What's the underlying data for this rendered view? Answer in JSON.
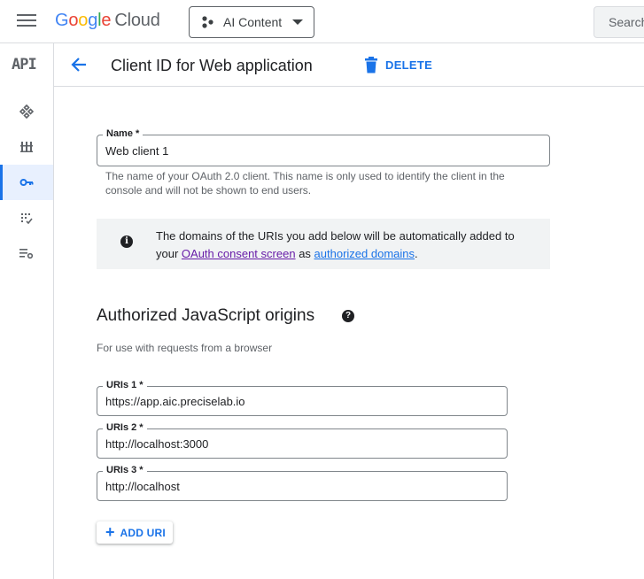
{
  "topbar": {
    "logo_google": [
      "G",
      "o",
      "o",
      "g",
      "l",
      "e"
    ],
    "logo_cloud": "Cloud",
    "project_label": "AI Content",
    "search_placeholder": "Search"
  },
  "rail": {
    "logo": "API",
    "items": [
      {
        "icon": "dashboard-icon"
      },
      {
        "icon": "library-icon"
      },
      {
        "icon": "key-icon",
        "active": true
      },
      {
        "icon": "consent-icon"
      },
      {
        "icon": "settings-list-icon"
      }
    ]
  },
  "header": {
    "title": "Client ID for Web application",
    "delete_label": "DELETE"
  },
  "form": {
    "name_label": "Name *",
    "name_value": "Web client 1",
    "name_helper": "The name of your OAuth 2.0 client. This name is only used to identify the client in the console and will not be shown to end users."
  },
  "info": {
    "text_before": "The domains of the URIs you add below will be automatically added to your",
    "consent_link": "OAuth consent screen",
    "text_mid": "as",
    "domains_link": "authorized domains",
    "text_end": "."
  },
  "origins": {
    "title": "Authorized JavaScript origins",
    "subtitle": "For use with requests from a browser",
    "uris": [
      {
        "label": "URIs 1 *",
        "value": "https://app.aic.preciselab.io"
      },
      {
        "label": "URIs 2 *",
        "value": "http://localhost:3000"
      },
      {
        "label": "URIs 3 *",
        "value": "http://localhost"
      }
    ],
    "add_label": "ADD URI"
  },
  "colors": {
    "accent": "#1a73e8",
    "link_visited": "#681da8",
    "info_bg": "#f1f3f4"
  }
}
